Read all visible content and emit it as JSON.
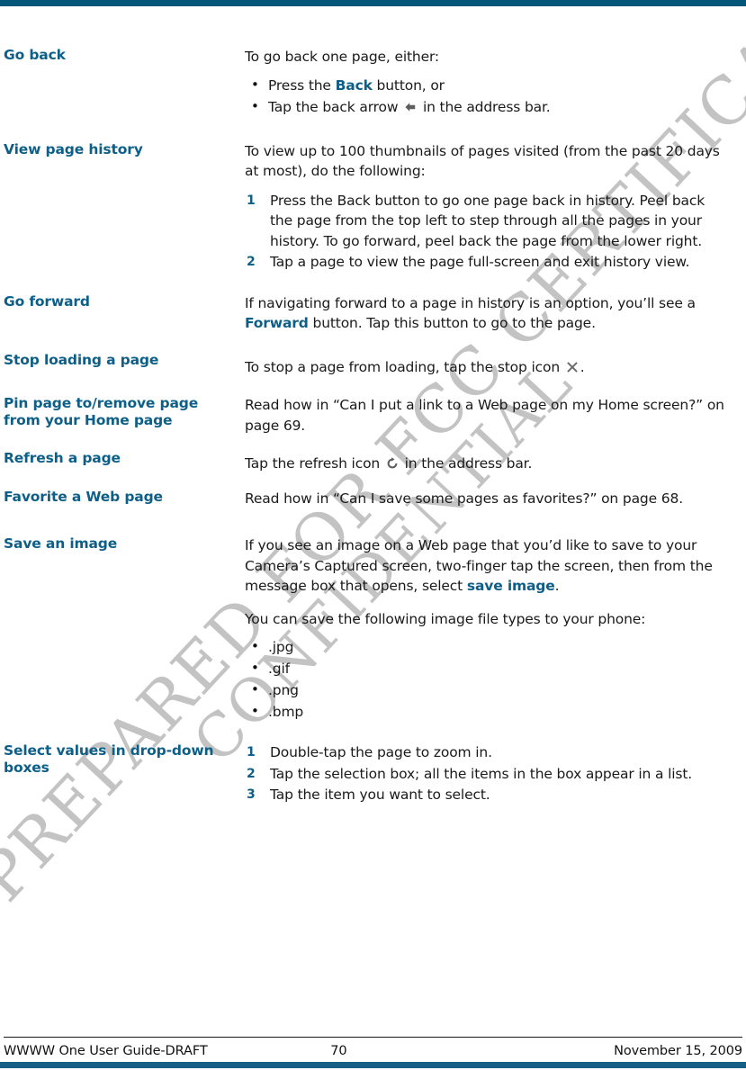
{
  "document": {
    "watermark": {
      "line1": "PREPARED FOR FCC CERTIFICATION",
      "line2": "CONFIDENTIAL"
    },
    "footer": {
      "left": "WWWW One User Guide-DRAFT",
      "page_number": "70",
      "right": "November 15, 2009"
    },
    "colors": {
      "heading": "#0e5f87",
      "top_rule": "#015679",
      "bottom_rule": "#155f87",
      "body_text": "#1a1a1a",
      "watermark": "#b9b9b9"
    },
    "rows": [
      {
        "term": "Go back",
        "intro": "To go back one page, either:",
        "bullets": [
          {
            "pre": "Press the ",
            "kw": "Back",
            "post": " button, or",
            "icon": null
          },
          {
            "pre": "Tap the back arrow ",
            "kw": null,
            "post": " in the address bar.",
            "icon": "back-arrow-icon"
          }
        ]
      },
      {
        "term": "View page history",
        "intro": "To view up to 100 thumbnails of pages visited (from the past 20 days at most), do the following:",
        "steps": [
          "Press the Back button to go one page back in history. Peel back the page from the top left to step through all the pages in your history. To go forward, peel back the page from the lower right.",
          "Tap a page to view the page full-screen and exit history view."
        ]
      },
      {
        "term": "Go forward",
        "para_pre": "If navigating forward to a page in history is an option, you’ll see a ",
        "para_kw": "Forward",
        "para_post": " button. Tap this button to go to the page."
      },
      {
        "term": "Stop loading a page",
        "para_pre": "To stop a page from loading, tap the stop icon ",
        "icon": "stop-x-icon",
        "para_post": "."
      },
      {
        "term": "Pin page to/remove page from your Home page",
        "para": "Read how in “Can I put a link to a Web page on my Home screen?” on page 69."
      },
      {
        "term": "Refresh a page",
        "para_pre": "Tap the refresh icon ",
        "icon": "refresh-icon",
        "para_post": " in the address bar."
      },
      {
        "term": "Favorite a Web page",
        "para": "Read how in “Can I save some pages as favorites?” on page 68."
      },
      {
        "term": "Save an image",
        "para1_pre": "If you see an image on a Web page that you’d like to save to your Camera’s Captured screen, two-finger tap the screen, then from the message box that opens, select ",
        "para1_kw": "save image",
        "para1_post": ".",
        "para2": "You can save the following image file types to your phone:",
        "file_types": [
          ".jpg",
          ".gif",
          ".png",
          ".bmp"
        ]
      },
      {
        "term": "Select values in drop-down boxes",
        "steps": [
          "Double-tap the page to zoom in.",
          "Tap the selection box; all the items in the box appear in a list.",
          "Tap the item you want to select."
        ]
      }
    ]
  }
}
